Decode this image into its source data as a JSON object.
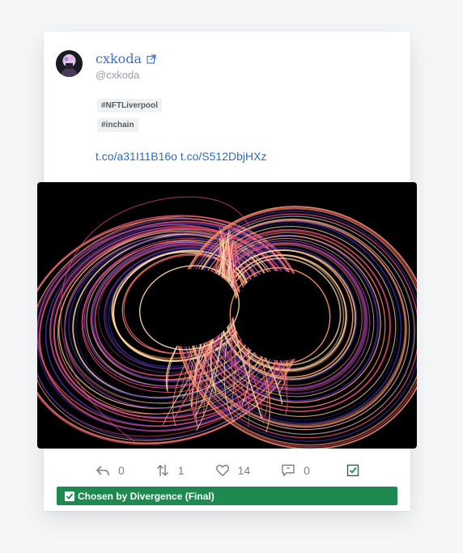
{
  "author": {
    "display_name": "cxkoda",
    "handle": "@cxkoda"
  },
  "tags": [
    "#NFTLiverpool",
    "#inchain"
  ],
  "links": [
    "t.co/a31I11B16o",
    "t.co/S512DbjHXz"
  ],
  "actions": {
    "reply_count": "0",
    "retweet_count": "1",
    "like_count": "14",
    "quote_count": "0"
  },
  "chosen_label": "Chosen by Divergence (Final)",
  "colors": {
    "link_blue": "#2c6cc4",
    "accent_green": "#1e8a4f",
    "art_palette": [
      "#ffd9a8",
      "#ff9a6b",
      "#e8507a",
      "#8a3fa8",
      "#3a2f9a"
    ]
  }
}
